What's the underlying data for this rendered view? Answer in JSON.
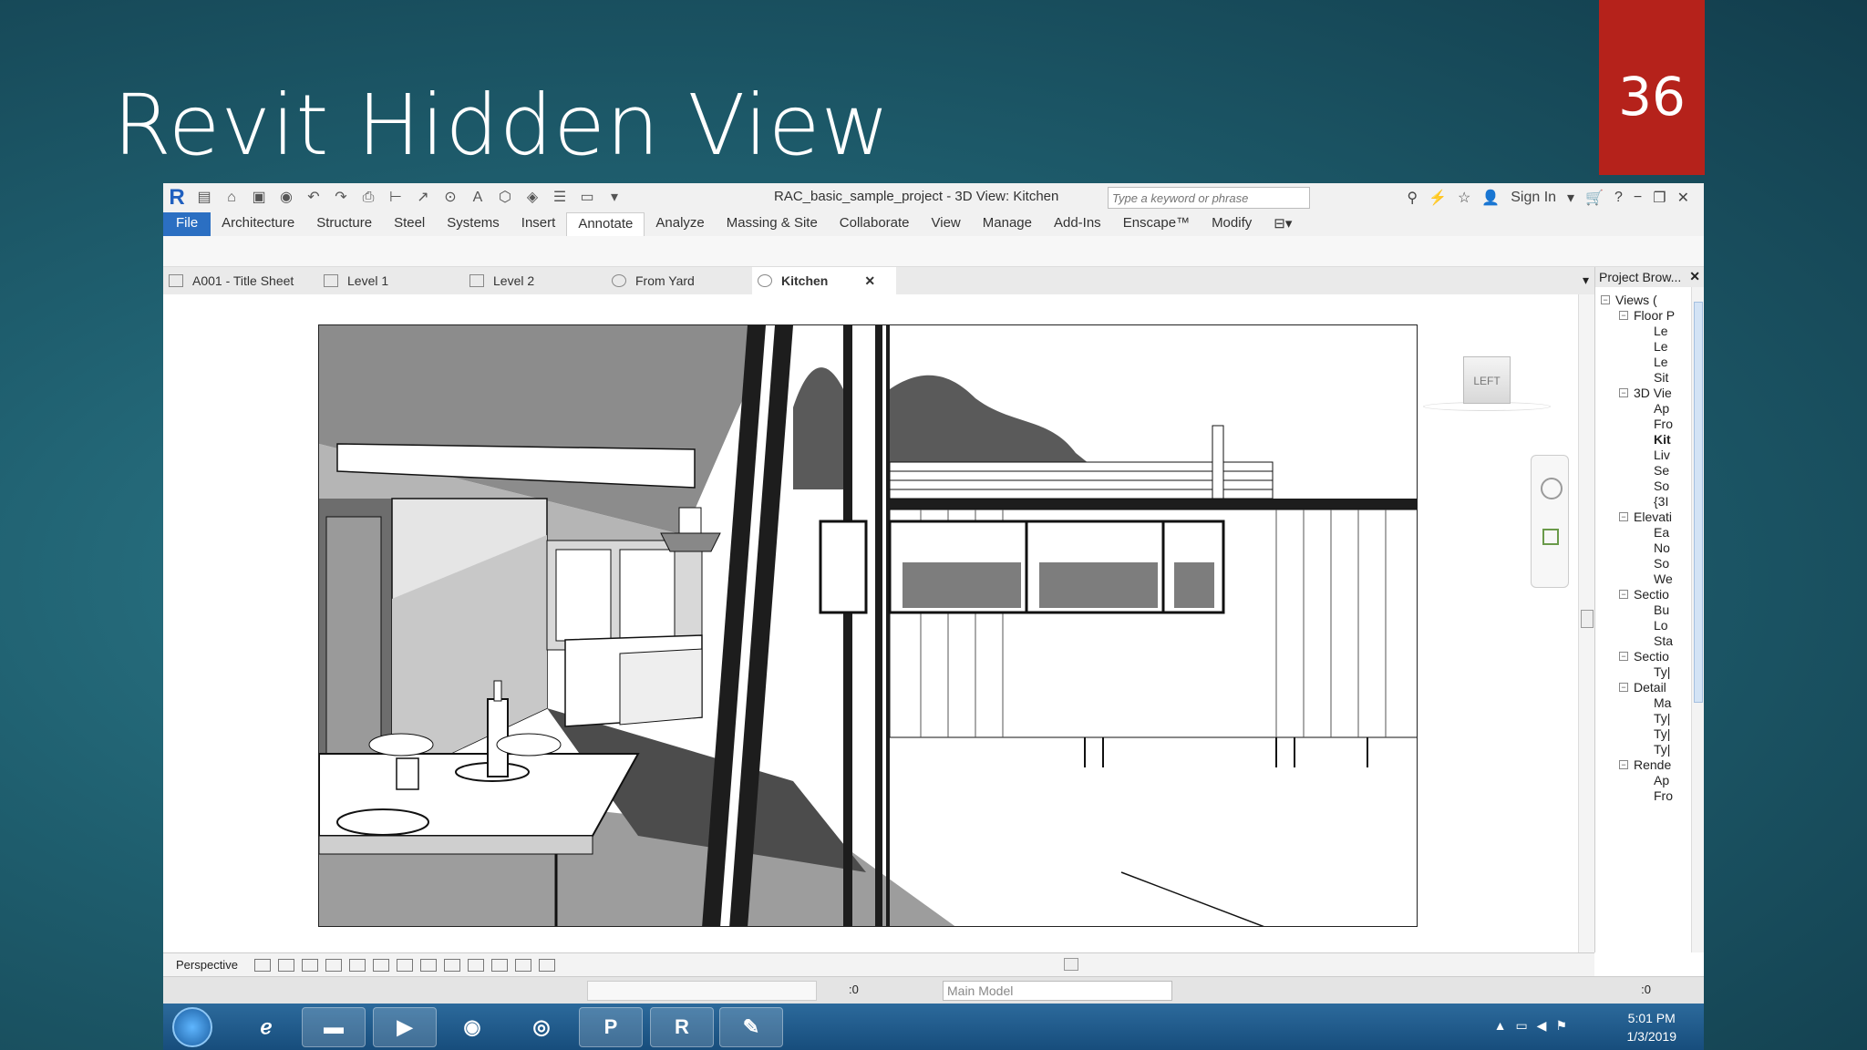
{
  "slide": {
    "title": "Revit Hidden View",
    "number": "36"
  },
  "app": {
    "logo": "R",
    "window_title": "RAC_basic_sample_project - 3D View: Kitchen",
    "search": {
      "placeholder": "Type a keyword or phrase"
    },
    "sign_in": "Sign In",
    "ribbon_tabs": [
      "File",
      "Architecture",
      "Structure",
      "Steel",
      "Systems",
      "Insert",
      "Annotate",
      "Analyze",
      "Massing & Site",
      "Collaborate",
      "View",
      "Manage",
      "Add-Ins",
      "Enscape™",
      "Modify"
    ],
    "active_ribbon_tab": "Annotate",
    "view_tabs": [
      "A001 - Title Sheet",
      "Level 1",
      "Level 2",
      "From Yard",
      "Kitchen"
    ],
    "active_view_tab": "Kitchen",
    "viewcube_label": "LEFT",
    "project_browser": {
      "title": "Project Brow...",
      "items": [
        "Views (",
        "Floor P",
        "Le",
        "Le",
        "Le",
        "Sit",
        "3D Vie",
        "Ap",
        "Fro",
        "Kit",
        "Liv",
        "Se",
        "So",
        "{3I",
        "Elevati",
        "Ea",
        "No",
        "So",
        "We",
        "Sectio",
        "Bu",
        "Lo",
        "Sta",
        "Sectio",
        "Ty|",
        "Detail",
        "Ma",
        "Ty|",
        "Ty|",
        "Ty|",
        "Rende",
        "Ap",
        "Fro"
      ]
    },
    "view_control": {
      "label": "Perspective"
    },
    "status": {
      "workset_value": ":0",
      "model": "Main Model",
      "filter_count": ":0"
    }
  },
  "taskbar": {
    "apps": [
      "start",
      "internet-explorer",
      "file-explorer",
      "media-player",
      "firefox",
      "chrome",
      "powerpoint",
      "revit",
      "paint"
    ],
    "revit_label": "R",
    "powerpoint_label": "P",
    "time": "5:01 PM",
    "date": "1/3/2019"
  },
  "colors": {
    "slide_bg": "#1f5f6f",
    "slide_number_bg": "#b5221b",
    "file_tab": "#2b6fc2",
    "taskbar": "#174d7c"
  }
}
